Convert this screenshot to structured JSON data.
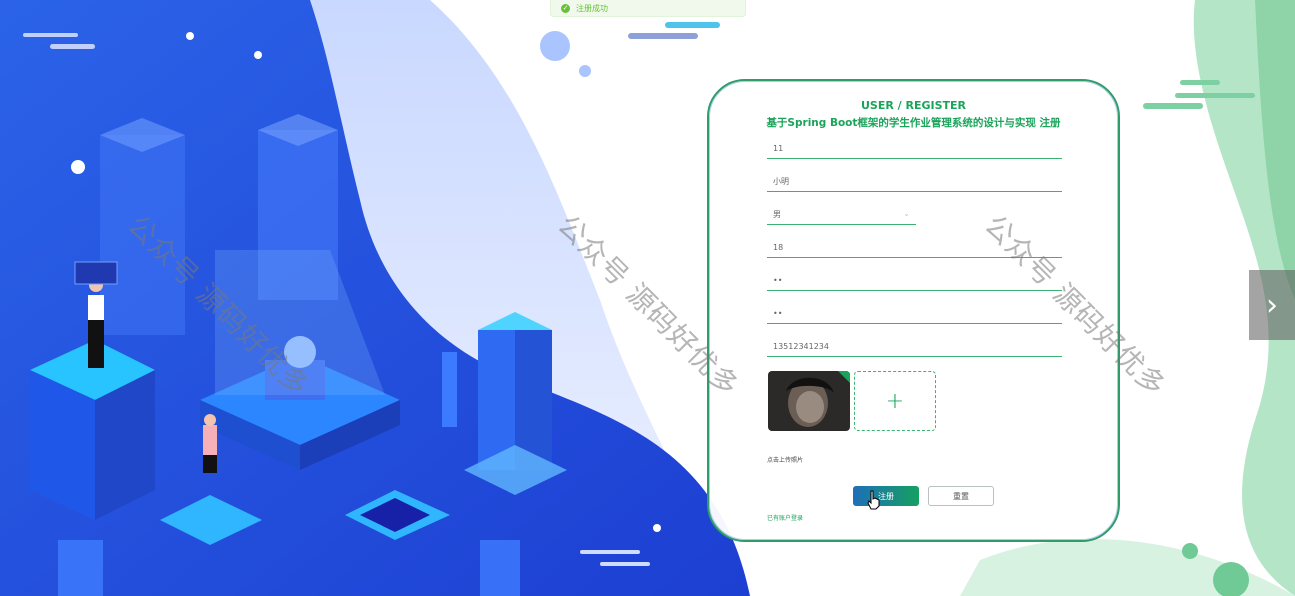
{
  "toast": {
    "message": "注册成功",
    "icon": "check-circle-icon"
  },
  "watermark": "公众号 源码好优多",
  "form": {
    "title_en": "USER / REGISTER",
    "title_cn": "基于Spring Boot框架的学生作业管理系统的设计与实现 注册",
    "account": "11",
    "name": "小明",
    "gender": "男",
    "age": "18",
    "password": "••",
    "confirm_password": "••",
    "phone": "13512341234",
    "upload_hint": "点击上传照片",
    "upload_plus": "+",
    "register_button": "注册",
    "reset_button": "重置",
    "login_link": "已有账户登录"
  },
  "colors": {
    "accent": "#1aa45a",
    "primary_blue": "#1e6fb8",
    "bg_blue": "#2563ea",
    "green_blob": "#a8e0bd"
  }
}
